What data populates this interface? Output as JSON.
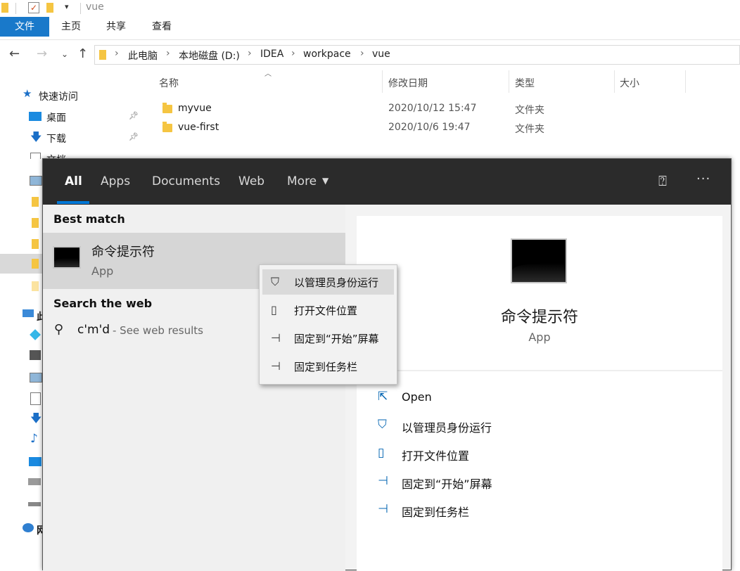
{
  "titlebar": {
    "title": "vue"
  },
  "ribbon": {
    "tabs": [
      "文件",
      "主页",
      "共享",
      "查看"
    ]
  },
  "address": {
    "crumbs": [
      "此电脑",
      "本地磁盘 (D:)",
      "IDEA",
      "workpace",
      "vue"
    ]
  },
  "nav": {
    "quick_access": "快速访问",
    "items": [
      {
        "label": "桌面",
        "icon": "desktop-icon",
        "pinned": true
      },
      {
        "label": "下载",
        "icon": "download-icon",
        "pinned": true
      },
      {
        "label": "文档",
        "icon": "document-icon",
        "pinned": true
      },
      {
        "label": "此",
        "icon": "this-pc-icon"
      },
      {
        "label": "网",
        "icon": "network-icon"
      }
    ]
  },
  "filelist": {
    "columns": [
      "名称",
      "修改日期",
      "类型",
      "大小"
    ],
    "rows": [
      {
        "name": "myvue",
        "date": "2020/10/12 15:47",
        "type": "文件夹",
        "size": ""
      },
      {
        "name": "vue-first",
        "date": "2020/10/6 19:47",
        "type": "文件夹",
        "size": ""
      }
    ]
  },
  "search": {
    "tabs": [
      "All",
      "Apps",
      "Documents",
      "Web",
      "More"
    ],
    "active_tab": "All",
    "best_match_header": "Best match",
    "best_match": {
      "name": "命令提示符",
      "kind": "App"
    },
    "web_header": "Search the web",
    "web_query": "c'm'd",
    "web_suffix": " - See web results",
    "detail": {
      "name": "命令提示符",
      "kind": "App",
      "actions": [
        {
          "label": "Open",
          "icon": "open-icon"
        },
        {
          "label": "以管理员身份运行",
          "icon": "admin-shield-icon"
        },
        {
          "label": "打开文件位置",
          "icon": "file-location-icon"
        },
        {
          "label": "固定到“开始”屏幕",
          "icon": "pin-start-icon"
        },
        {
          "label": "固定到任务栏",
          "icon": "pin-taskbar-icon"
        }
      ]
    }
  },
  "context_menu": {
    "items": [
      {
        "label": "以管理员身份运行",
        "icon": "admin-shield-icon",
        "highlighted": true
      },
      {
        "label": "打开文件位置",
        "icon": "file-location-icon"
      },
      {
        "label": "固定到“开始”屏幕",
        "icon": "pin-start-icon"
      },
      {
        "label": "固定到任务栏",
        "icon": "pin-taskbar-icon"
      }
    ]
  },
  "colors": {
    "accent": "#0078d7",
    "file_tab": "#1979ca",
    "flyout_header": "#2b2b2b"
  }
}
